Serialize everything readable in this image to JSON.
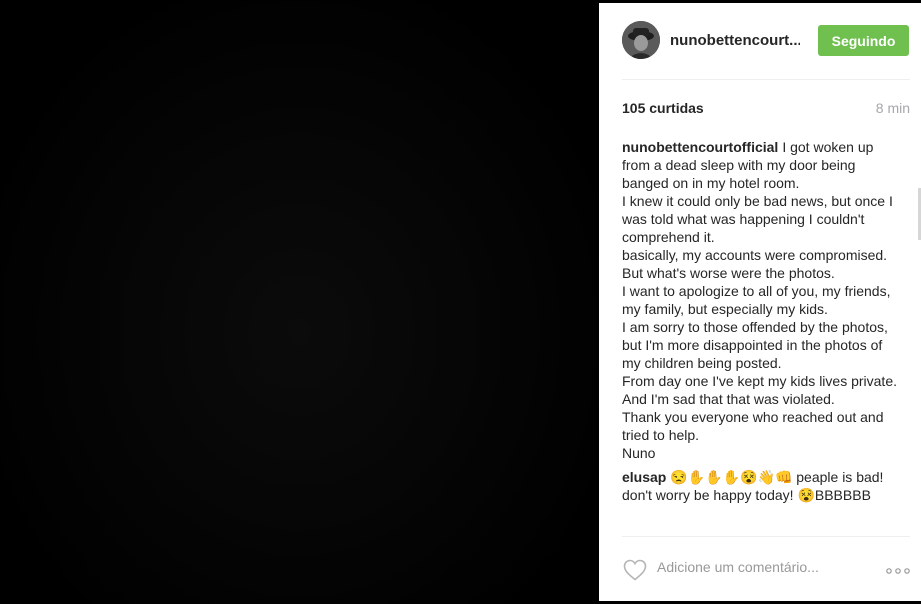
{
  "post": {
    "username": "nunobettencourt...",
    "follow_label": "Seguindo",
    "likes": "105 curtidas",
    "time_ago": "8 min"
  },
  "caption": {
    "author": "nunobettencourtofficial",
    "first_line": "I got woken up from a dead sleep with my door being banged on in my hotel room.",
    "lines": [
      "I knew it could only be bad news, but once I was told what was happening I couldn't comprehend it.",
      "basically, my accounts were compromised.",
      "But what's worse were the photos.",
      "I want to apologize to all of you, my friends, my family, but especially my kids.",
      "I am sorry to those offended by the photos, but I'm more disappointed in the photos of my children being posted.",
      "From day one I've kept my kids lives private. And I'm sad that that was violated.",
      "Thank you everyone who reached out and tried to help.",
      "Nuno"
    ]
  },
  "second_comment": {
    "author": "elusap",
    "text": "😒✋✋✋😵👋👊 peaple is bad! don't worry be happy today! 😵BBBBBB"
  },
  "add_comment": {
    "placeholder": "Adicione um comentário..."
  },
  "icons": {
    "like": "heart-icon",
    "options": "more-options-icon"
  }
}
